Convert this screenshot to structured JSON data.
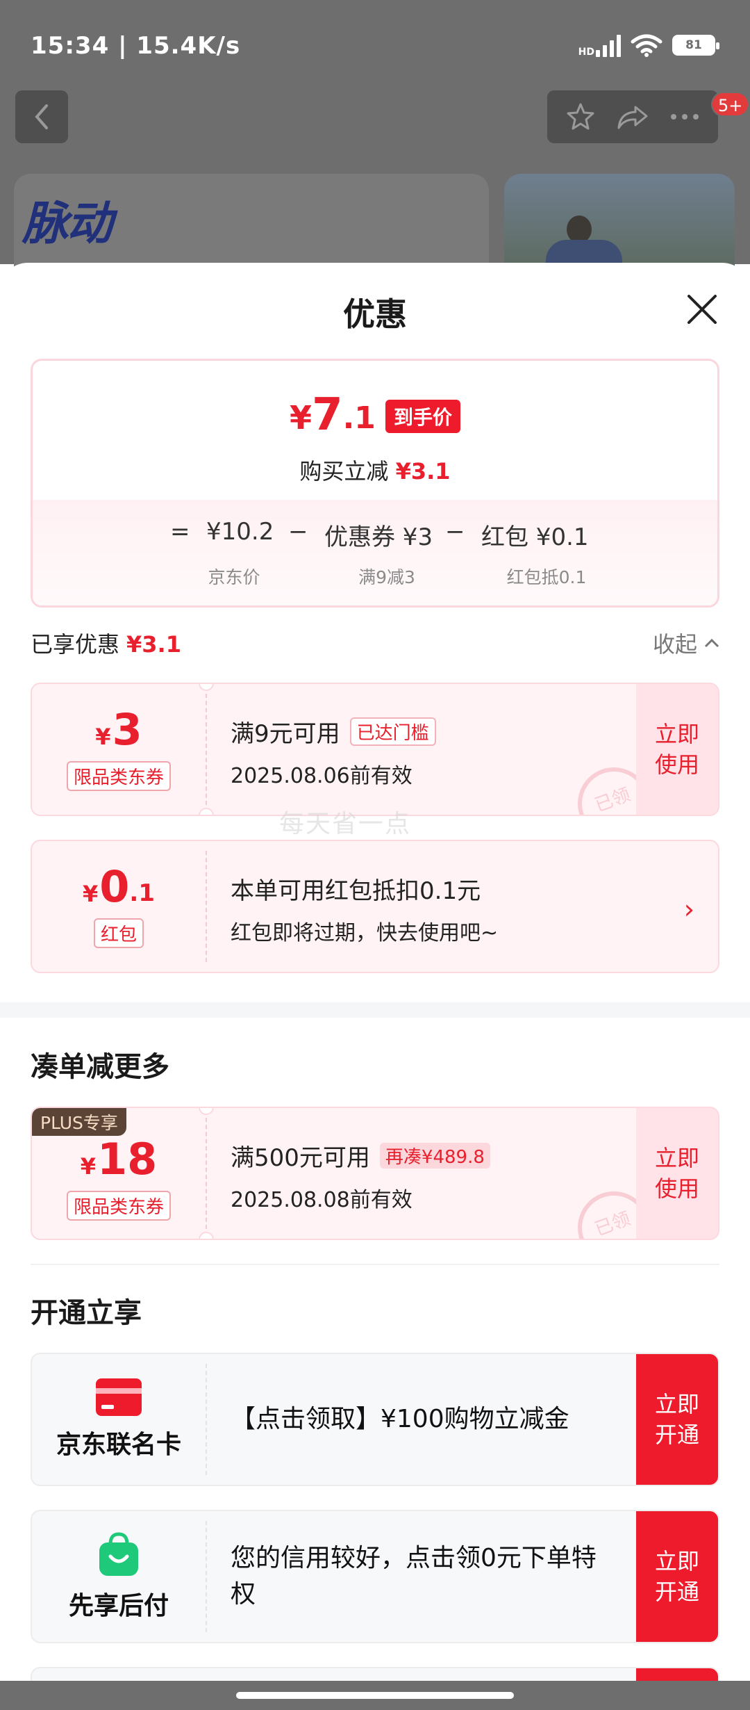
{
  "status_bar": {
    "time_speed": "15:34 | 15.4K/s",
    "network": "HD",
    "battery": "81"
  },
  "background": {
    "badge": "5+",
    "brand_logo": "脉动"
  },
  "sheet": {
    "title": "优惠",
    "final_price": {
      "yen": "¥",
      "integer": "7",
      "decimal": ".1",
      "tag": "到手价"
    },
    "instant_reduce": {
      "label": "购买立减",
      "value": "¥3.1"
    },
    "formula": {
      "eq": "=",
      "items": [
        {
          "main": "¥10.2",
          "sub": "京东价"
        },
        {
          "main": "优惠券 ¥3",
          "sub": "满9减3"
        },
        {
          "main": "红包 ¥0.1",
          "sub": "红包抵0.1"
        }
      ],
      "minus": "−"
    },
    "enjoyed": {
      "label": "已享优惠",
      "value": "¥3.1",
      "collapse": "收起"
    },
    "coupon_1": {
      "yen": "¥",
      "amount": "3",
      "type": "限品类东券",
      "title": "满9元可用",
      "tag": "已达门槛",
      "validity": "2025.08.06前有效",
      "action": "立即\n使用",
      "stamp": "已领"
    },
    "redpacket": {
      "yen": "¥",
      "amount": "0",
      "decimal": ".1",
      "type": "红包",
      "title": "本单可用红包抵扣0.1元",
      "desc": "红包即将过期，快去使用吧~"
    },
    "watermark": "每天省一点",
    "more_section": {
      "title": "凑单减更多"
    },
    "coupon_2": {
      "plus_tag": "PLUS专享",
      "yen": "¥",
      "amount": "18",
      "type": "限品类东券",
      "title": "满500元可用",
      "tag": "再凑¥489.8",
      "validity": "2025.08.08前有效",
      "action": "立即\n使用",
      "stamp": "已领"
    },
    "open_section": {
      "title": "开通立享"
    },
    "service_1": {
      "name": "京东联名卡",
      "text": "【点击领取】¥100购物立减金",
      "action": "立即\n开通"
    },
    "service_2": {
      "name": "先享后付",
      "text": "您的信用较好，点击领0元下单特权",
      "action": "立即\n开通"
    }
  },
  "colors": {
    "accent": "#e8202e",
    "button_red": "#ee1b2c",
    "green": "#1fc97a"
  }
}
